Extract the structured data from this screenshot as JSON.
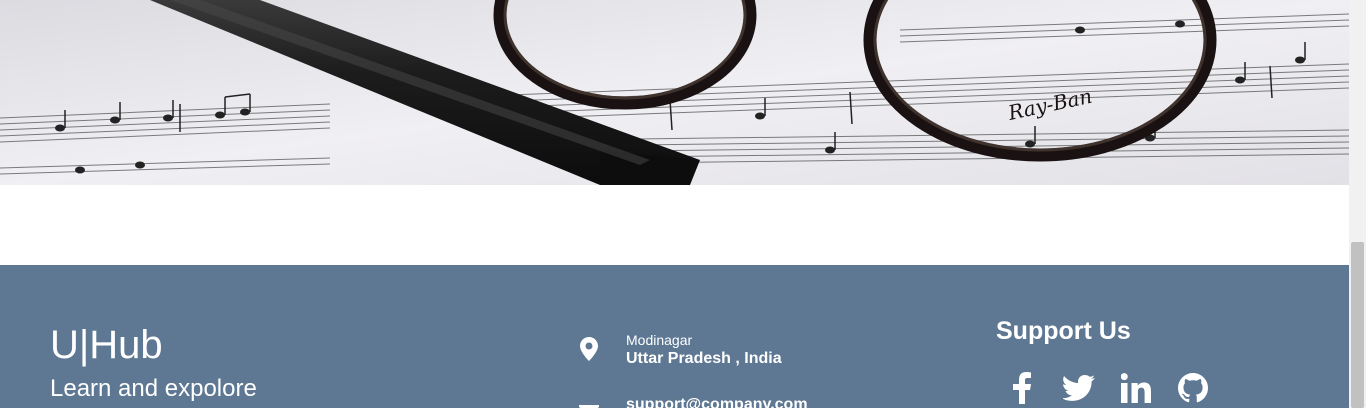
{
  "hero": {
    "image_alt": "Eyeglasses and pencil resting on sheet music",
    "brand_on_glasses": "Ray-Ban"
  },
  "footer": {
    "background_color": "#5e7893",
    "brand": {
      "title": "U|Hub",
      "tagline": "Learn and expolore"
    },
    "contact": {
      "location": {
        "icon": "map-marker-icon",
        "city": "Modinagar",
        "region": "Uttar Pradesh , India"
      },
      "email": {
        "icon": "envelope-icon",
        "address": "support@company.com"
      }
    },
    "support": {
      "title": "Support Us",
      "social": [
        {
          "name": "facebook",
          "icon": "facebook-icon"
        },
        {
          "name": "twitter",
          "icon": "twitter-icon"
        },
        {
          "name": "linkedin",
          "icon": "linkedin-icon"
        },
        {
          "name": "github",
          "icon": "github-icon"
        }
      ]
    }
  }
}
